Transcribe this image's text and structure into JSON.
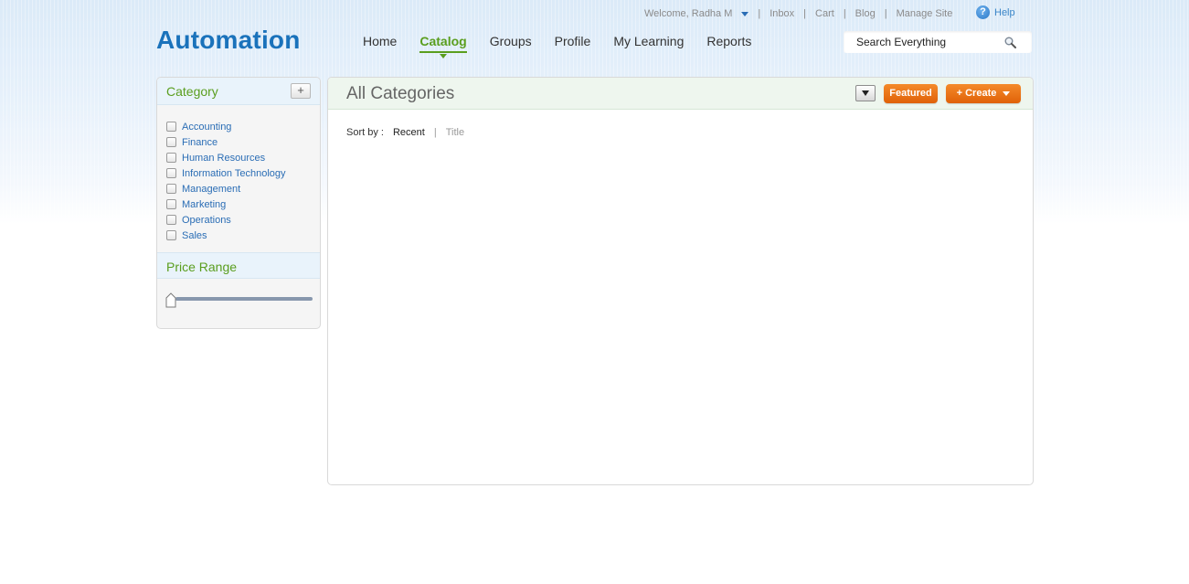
{
  "header": {
    "welcome": "Welcome, Radha M",
    "util_links": [
      "Inbox",
      "Cart",
      "Blog",
      "Manage Site"
    ],
    "help": "Help",
    "logo": "Automation"
  },
  "nav": {
    "items": [
      {
        "label": "Home",
        "active": false
      },
      {
        "label": "Catalog",
        "active": true
      },
      {
        "label": "Groups",
        "active": false
      },
      {
        "label": "Profile",
        "active": false
      },
      {
        "label": "My Learning",
        "active": false
      },
      {
        "label": "Reports",
        "active": false
      }
    ]
  },
  "search": {
    "placeholder": "Search Everything"
  },
  "sidebar": {
    "category_title": "Category",
    "add_label": "+",
    "categories": [
      "Accounting",
      "Finance",
      "Human Resources",
      "Information Technology",
      "Management",
      "Marketing",
      "Operations",
      "Sales"
    ],
    "price_title": "Price Range",
    "price_slider_value": 0
  },
  "main": {
    "title": "All Categories",
    "featured_label": "Featured",
    "create_label": "+ Create",
    "sort_label": "Sort by :",
    "sort_options": [
      "Recent",
      "Title"
    ],
    "sort_separator": "|"
  },
  "colors": {
    "brand_blue": "#1a72bb",
    "active_green": "#5a9e1e",
    "button_orange": "#e06108",
    "link_blue": "#2a6db5"
  }
}
